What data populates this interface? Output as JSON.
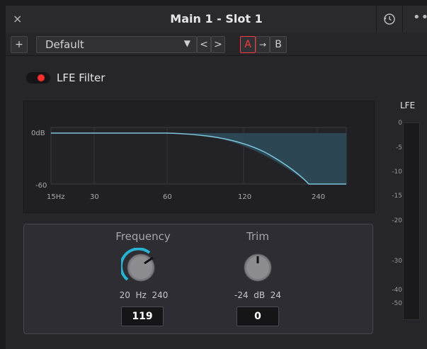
{
  "titlebar": {
    "title": "Main 1 - Slot 1",
    "close_icon": "close-icon",
    "history_icon": "history-icon",
    "more_icon": "more-icon",
    "close_glyph": "×",
    "more_glyph": "•••"
  },
  "toolbar": {
    "add_label": "+",
    "preset_name": "Default",
    "prev_label": "<",
    "next_label": ">",
    "compare_a": "A",
    "compare_arrow": "→",
    "compare_b": "B",
    "accent_color": "#ff3a3a"
  },
  "filter": {
    "enabled": true,
    "label": "LFE Filter",
    "toggle_color": "#ff2e2e"
  },
  "graph": {
    "y_labels": [
      "0dB",
      "-60"
    ],
    "x_labels": [
      "15Hz",
      "30",
      "60",
      "120",
      "240"
    ],
    "curve_color": "#7cc6dc",
    "fill_color": "#2e4a5a"
  },
  "controls": {
    "frequency": {
      "title": "Frequency",
      "min": "20",
      "unit": "Hz",
      "max": "240",
      "value": "119",
      "arc_color": "#27b4d4"
    },
    "trim": {
      "title": "Trim",
      "min": "-24",
      "unit": "dB",
      "max": "24",
      "value": "0"
    }
  },
  "meter": {
    "title": "LFE",
    "ticks": [
      "0",
      "-5",
      "-10",
      "-15",
      "-20",
      "-30",
      "-40",
      "-50"
    ]
  }
}
